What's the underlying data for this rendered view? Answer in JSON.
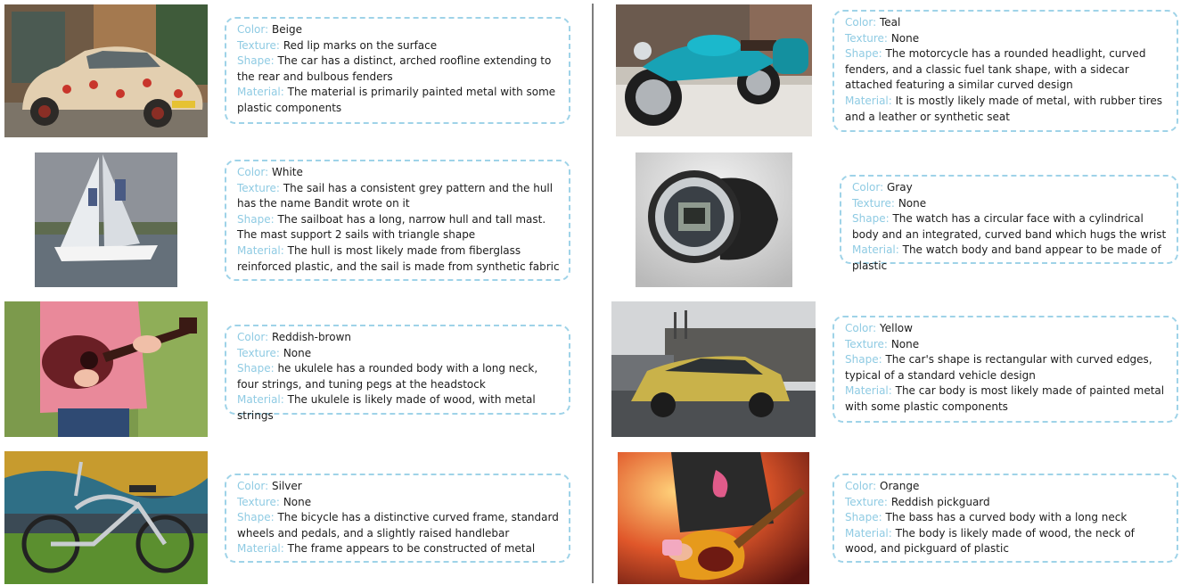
{
  "field_labels": {
    "color": "Color:",
    "texture": "Texture:",
    "shape": "Shape:",
    "material": "Material:"
  },
  "accent_color": "#8fcbe3",
  "items": [
    {
      "image": "beige-car-photo",
      "color": "Beige",
      "texture": "Red lip marks on the surface",
      "shape": "The car has a distinct, arched roofline extending to the rear and bulbous fenders",
      "material": "The material is primarily painted metal with some plastic components"
    },
    {
      "image": "sailboat-photo",
      "color": "White",
      "texture": "The sail has a consistent grey pattern and the hull has the name Bandit wrote on it",
      "shape": "The sailboat has a long, narrow hull and tall mast. The mast support 2 sails with triangle shape",
      "material": "The hull is most likely made from fiberglass reinforced plastic, and the sail is made from synthetic fabric"
    },
    {
      "image": "ukulele-photo",
      "color": "Reddish-brown",
      "texture": "None",
      "shape": "he ukulele has a rounded body with a long neck, four strings, and tuning pegs at the headstock",
      "material": "The ukulele is likely made of wood, with metal strings"
    },
    {
      "image": "bicycle-photo",
      "color": "Silver",
      "texture": "None",
      "shape": "The bicycle has a distinctive curved frame, standard wheels and pedals, and a slightly raised handlebar",
      "material": "The frame appears to be constructed of metal"
    },
    {
      "image": "motorcycle-photo",
      "color": "Teal",
      "texture": "None",
      "shape": "The motorcycle has a rounded headlight, curved fenders, and a classic fuel tank shape, with a sidecar attached featuring a similar curved design",
      "material": "It is mostly likely made of metal, with rubber tires and a leather or synthetic seat"
    },
    {
      "image": "watch-photo",
      "color": "Gray",
      "texture": "None",
      "shape": "The watch has a circular face with a cylindrical body and an integrated, curved band which hugs the wrist",
      "material": "The watch body and band appear to be made of plastic"
    },
    {
      "image": "yellow-car-photo",
      "color": "Yellow",
      "texture": "None",
      "shape": "The car's shape is rectangular with curved edges, typical of a standard vehicle design",
      "material": "The car body is most likely made of painted metal with some plastic components"
    },
    {
      "image": "bass-guitar-photo",
      "color": "Orange",
      "texture": "Reddish pickguard",
      "shape": "The bass has a curved body with a long neck",
      "material": "The body is likely made of wood, the neck of wood, and pickguard of plastic"
    }
  ]
}
